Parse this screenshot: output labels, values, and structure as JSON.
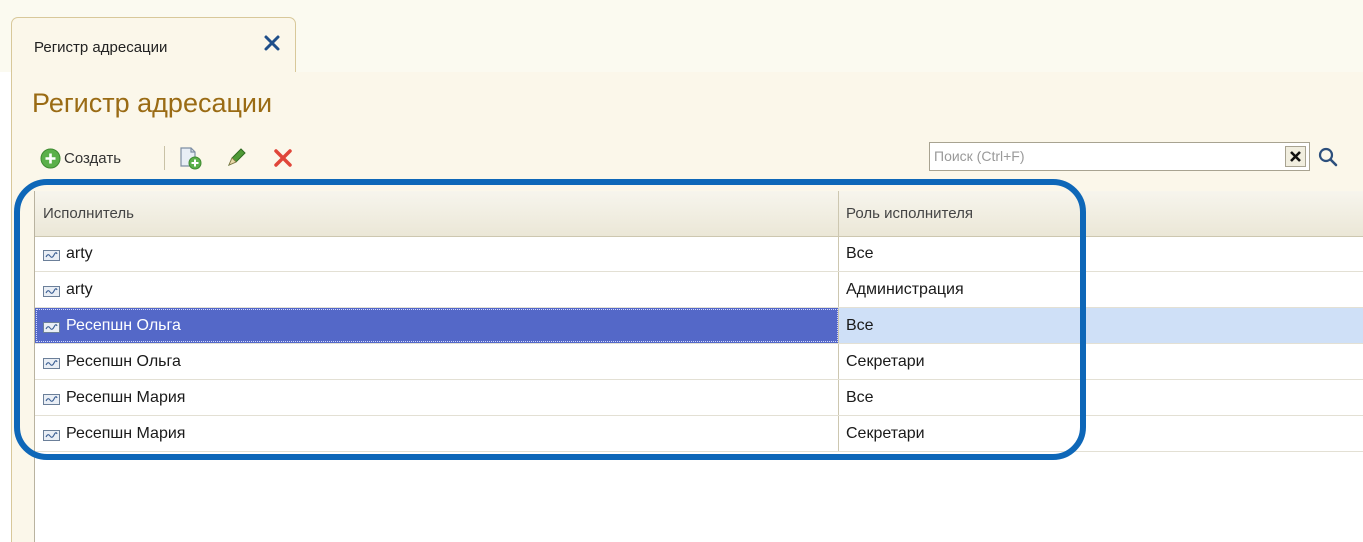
{
  "tab": {
    "label": "Регистр адресации"
  },
  "page": {
    "title": "Регистр адресации"
  },
  "toolbar": {
    "create_label": "Создать"
  },
  "search": {
    "placeholder": "Поиск (Ctrl+F)",
    "value": ""
  },
  "table": {
    "columns": [
      "Исполнитель",
      "Роль исполнителя"
    ],
    "rows": [
      {
        "executor": "arty",
        "role": "Все",
        "selected": false
      },
      {
        "executor": "arty",
        "role": "Администрация",
        "selected": false
      },
      {
        "executor": "Ресепшн Ольга",
        "role": "Все",
        "selected": true
      },
      {
        "executor": "Ресепшн Ольга",
        "role": "Секретари",
        "selected": false
      },
      {
        "executor": "Ресепшн Мария",
        "role": "Все",
        "selected": false
      },
      {
        "executor": "Ресепшн Мария",
        "role": "Секретари",
        "selected": false
      }
    ]
  },
  "icons": {
    "tab_close": "close-icon",
    "create": "plus-icon",
    "copy": "copy-document-icon",
    "edit": "pencil-icon",
    "delete": "delete-icon",
    "search_clear": "clear-icon",
    "search": "search-icon",
    "row": "user-record-icon"
  },
  "colors": {
    "title": "#9a6b14",
    "selection": "#5468c8",
    "selection_row": "#cfe0f7",
    "highlight": "#0e67b8"
  }
}
